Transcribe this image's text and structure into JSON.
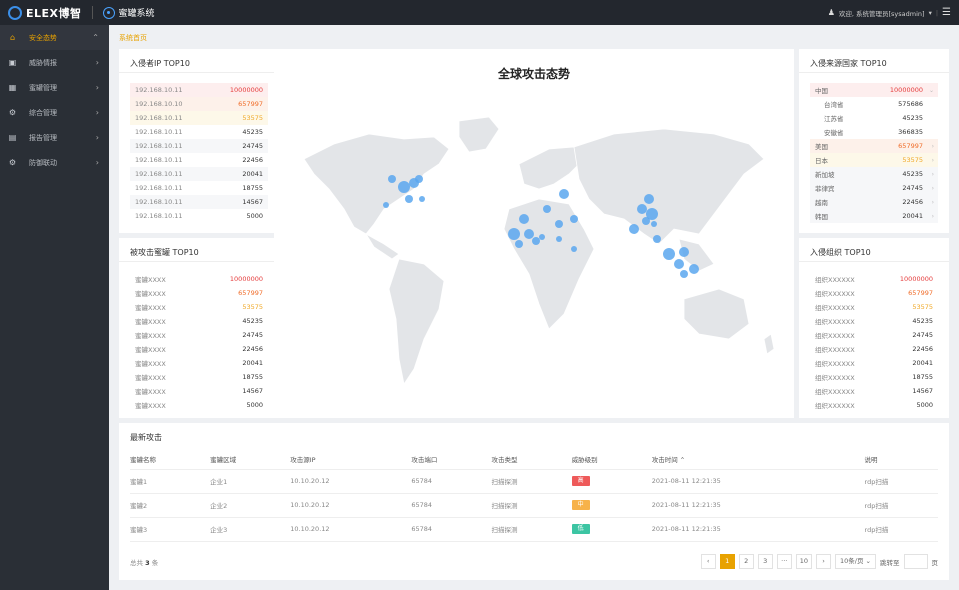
{
  "header": {
    "logo_text": "ELEX博智",
    "system_name": "蜜罐系统",
    "welcome": "欢迎, 系统管理员[sysadmin]"
  },
  "sidebar": {
    "items": [
      {
        "label": "安全态势",
        "icon": "home-icon"
      },
      {
        "label": "威胁情报",
        "icon": "image-icon"
      },
      {
        "label": "蜜罐管理",
        "icon": "grid-icon"
      },
      {
        "label": "综合管理",
        "icon": "gear-icon"
      },
      {
        "label": "报告管理",
        "icon": "report-icon"
      },
      {
        "label": "防御联动",
        "icon": "gear-icon"
      }
    ]
  },
  "breadcrumb": "系统首页",
  "intruder_ip": {
    "title": "入侵者IP TOP10",
    "rows": [
      {
        "name": "192.168.10.11",
        "value": "10000000"
      },
      {
        "name": "192.168.10.10",
        "value": "657997"
      },
      {
        "name": "192.168.10.11",
        "value": "53575"
      },
      {
        "name": "192.168.10.11",
        "value": "45235"
      },
      {
        "name": "192.168.10.11",
        "value": "24745"
      },
      {
        "name": "192.168.10.11",
        "value": "22456"
      },
      {
        "name": "192.168.10.11",
        "value": "20041"
      },
      {
        "name": "192.168.10.11",
        "value": "18755"
      },
      {
        "name": "192.168.10.11",
        "value": "14567"
      },
      {
        "name": "192.168.10.11",
        "value": "5000"
      }
    ]
  },
  "attacked_honeypot": {
    "title": "被攻击蜜罐 TOP10",
    "rows": [
      {
        "name": "蜜罐XXXX",
        "value": "10000000"
      },
      {
        "name": "蜜罐XXXX",
        "value": "657997"
      },
      {
        "name": "蜜罐XXXX",
        "value": "53575"
      },
      {
        "name": "蜜罐XXXX",
        "value": "45235"
      },
      {
        "name": "蜜罐XXXX",
        "value": "24745"
      },
      {
        "name": "蜜罐XXXX",
        "value": "22456"
      },
      {
        "name": "蜜罐XXXX",
        "value": "20041"
      },
      {
        "name": "蜜罐XXXX",
        "value": "18755"
      },
      {
        "name": "蜜罐XXXX",
        "value": "14567"
      },
      {
        "name": "蜜罐XXXX",
        "value": "5000"
      }
    ]
  },
  "map": {
    "title": "全球攻击态势",
    "land_color": "#e3e5e8",
    "dot_color": "#5ba7ee"
  },
  "source_country": {
    "title": "入侵来源国家 TOP10",
    "rows": [
      {
        "name": "中国",
        "value": "10000000",
        "sub": false
      },
      {
        "name": "台湾省",
        "value": "575686",
        "sub": true
      },
      {
        "name": "江苏省",
        "value": "45235",
        "sub": true
      },
      {
        "name": "安徽省",
        "value": "366835",
        "sub": true
      },
      {
        "name": "美国",
        "value": "657997",
        "sub": false
      },
      {
        "name": "日本",
        "value": "53575",
        "sub": false
      },
      {
        "name": "新加坡",
        "value": "45235",
        "sub": false
      },
      {
        "name": "菲律宾",
        "value": "24745",
        "sub": false
      },
      {
        "name": "越南",
        "value": "22456",
        "sub": false
      },
      {
        "name": "韩国",
        "value": "20041",
        "sub": false
      }
    ]
  },
  "intruder_org": {
    "title": "入侵组织 TOP10",
    "rows": [
      {
        "name": "组织XXXXXX",
        "value": "10000000"
      },
      {
        "name": "组织XXXXXX",
        "value": "657997"
      },
      {
        "name": "组织XXXXXX",
        "value": "53575"
      },
      {
        "name": "组织XXXXXX",
        "value": "45235"
      },
      {
        "name": "组织XXXXXX",
        "value": "24745"
      },
      {
        "name": "组织XXXXXX",
        "value": "22456"
      },
      {
        "name": "组织XXXXXX",
        "value": "20041"
      },
      {
        "name": "组织XXXXXX",
        "value": "18755"
      },
      {
        "name": "组织XXXXXX",
        "value": "14567"
      },
      {
        "name": "组织XXXXXX",
        "value": "5000"
      }
    ]
  },
  "latest": {
    "title": "最新攻击",
    "columns": [
      "蜜罐名称",
      "蜜罐区域",
      "攻击源IP",
      "攻击端口",
      "攻击类型",
      "威胁级别",
      "攻击时间 ⌃",
      "说明"
    ],
    "rows": [
      {
        "name": "蜜罐1",
        "zone": "企业1",
        "ip": "10.10.20.12",
        "port": "65784",
        "type": "扫描探测",
        "level": "高",
        "level_color": "#ee5a5a",
        "time": "2021-08-11  12:21:35",
        "note": "rdp扫描"
      },
      {
        "name": "蜜罐2",
        "zone": "企业2",
        "ip": "10.10.20.12",
        "port": "65784",
        "type": "扫描探测",
        "level": "中",
        "level_color": "#f7b24a",
        "time": "2021-08-11  12:21:35",
        "note": "rdp扫描"
      },
      {
        "name": "蜜罐3",
        "zone": "企业3",
        "ip": "10.10.20.12",
        "port": "65784",
        "type": "扫描探测",
        "level": "低",
        "level_color": "#3cc5a3",
        "time": "2021-08-11  12:21:35",
        "note": "rdp扫描"
      }
    ],
    "total_prefix": "总共",
    "total_count": "3",
    "total_suffix": "条",
    "pages": [
      "1",
      "2",
      "3",
      "···",
      "10"
    ],
    "page_size": "10条/页",
    "jump_label": "跳转至",
    "page_unit": "页"
  },
  "colors": {
    "accent": "#e8a200",
    "sidebar": "#2a2f36",
    "topbar": "#23272e"
  }
}
